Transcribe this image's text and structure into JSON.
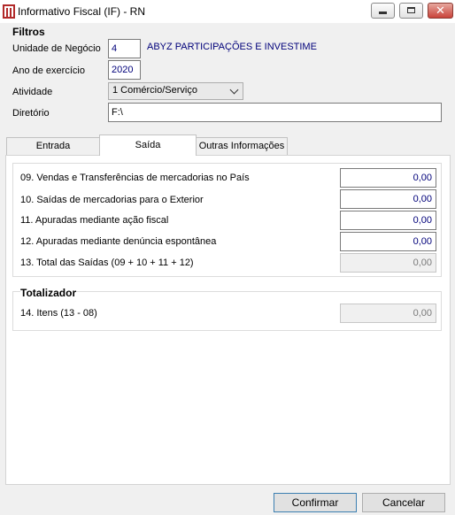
{
  "window": {
    "title": "Informativo Fiscal (IF) - RN",
    "icon": "app-logo-icon",
    "controls": [
      "minimize-icon",
      "maximize-icon",
      "close-icon"
    ],
    "close_glyph": "✕"
  },
  "filtros": {
    "title": "Filtros",
    "unidade": {
      "label": "Unidade de Negócio",
      "value": "4",
      "name": "ABYZ PARTICIPAÇÕES E INVESTIME"
    },
    "ano": {
      "label": "Ano de exercício",
      "value": "2020"
    },
    "atividade": {
      "label": "Atividade",
      "value": "1 Comércio/Serviço"
    },
    "diretorio": {
      "label": "Diretório",
      "value": "F:\\"
    }
  },
  "tabs": [
    {
      "label": "Entrada",
      "active": false
    },
    {
      "label": "Saída",
      "active": true
    },
    {
      "label": "Outras Informações",
      "active": false
    }
  ],
  "saida": {
    "rows": [
      {
        "label": "09. Vendas e Transferências de mercadorias no País",
        "value": "0,00",
        "enabled": true
      },
      {
        "label": "10. Saídas de mercadorias para o Exterior",
        "value": "0,00",
        "enabled": true
      },
      {
        "label": "11. Apuradas mediante ação fiscal",
        "value": "0,00",
        "enabled": true
      },
      {
        "label": "12. Apuradas mediante denúncia espontânea",
        "value": "0,00",
        "enabled": true
      },
      {
        "label": "13. Total das Saídas (09 + 10 + 11 + 12)",
        "value": "0,00",
        "enabled": false
      }
    ]
  },
  "totalizador": {
    "title": "Totalizador",
    "row": {
      "label": "14. Itens (13 - 08)",
      "value": "0,00",
      "enabled": false
    }
  },
  "buttons": {
    "confirm": "Confirmar",
    "cancel": "Cancelar"
  },
  "colors": {
    "field_text": "#00007a",
    "window_bg": "#f0f0f0",
    "close_button": "#c9433a",
    "logo": "#b22a2a"
  }
}
